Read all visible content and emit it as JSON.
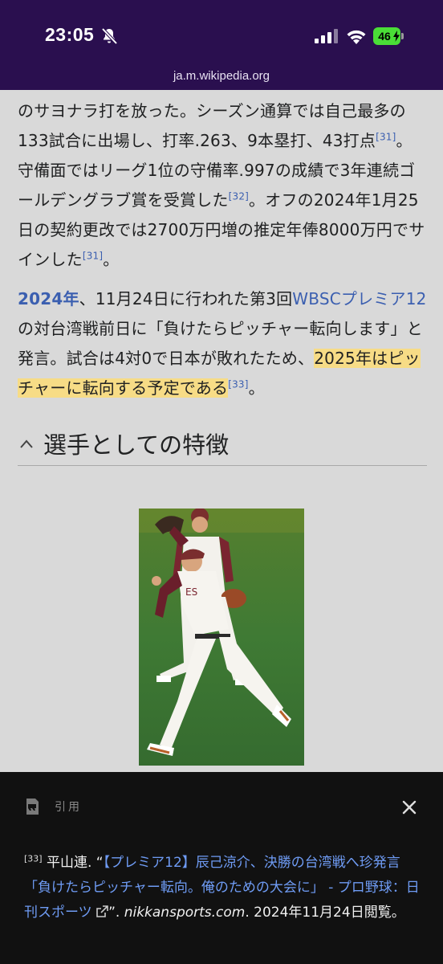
{
  "status_bar": {
    "time": "23:05",
    "battery": "46",
    "background_color": "#2a0f4f",
    "url": "ja.m.wikipedia.org",
    "icons": [
      "bell-off-icon",
      "cell-signal-icon",
      "wifi-icon",
      "battery-icon"
    ]
  },
  "article": {
    "para1": {
      "t1": "のサヨナラ打を放った。シーズン通算では自己最多の133試合に出場し、打率.263、9本塁打、43打点",
      "r1": "[31]",
      "t2": "。守備面ではリーグ1位の守備率.997の成績で3年連続ゴールデングラブ賞を受賞した",
      "r2": "[32]",
      "t3": "。オフの2024年1月25日の契約更改では2700万円増の推定年俸8000万円でサインした",
      "r3": "[31]",
      "t4": "。"
    },
    "para2": {
      "year_link": "2024年",
      "t1": "、11月24日に行われた第3回",
      "event_link": "WBSCプレミア12",
      "t2": "の対台湾戦前日に「負けたらピッチャー転向します」と発言。試合は4対0で日本が敗れたため、",
      "highlight": "2025年はピッチャーに転向する予定である",
      "r1": "[33]",
      "t3": "。"
    },
    "section_heading": "選手としての特徴",
    "link_color": "#3b5fb0",
    "highlight_color": "#f7dc86"
  },
  "citation_sheet": {
    "label": "引用",
    "ref_num": "[33]",
    "author": "平山連. “",
    "title": "【プレミア12】辰己涼介、決勝の台湾戦へ珍発言「負けたらピッチャー転向。俺のための大会に」 - プロ野球：日刊スポーツ",
    "close_quote": "”. ",
    "site": "nikkansports.com",
    "accessed": ". 2024年11月24日閲覧。"
  }
}
